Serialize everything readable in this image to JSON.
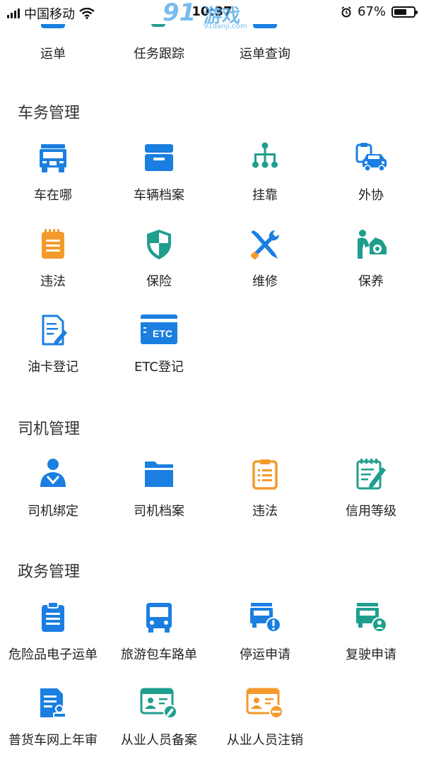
{
  "status_bar": {
    "carrier": "中国移动",
    "time": "10:37",
    "battery_percent": "67%",
    "battery_level": 0.67
  },
  "watermark": {
    "big": "91",
    "cn": "游戏",
    "small": "91danji.com"
  },
  "top_row": [
    {
      "label": "运单",
      "icon": "waybill-icon"
    },
    {
      "label": "任务跟踪",
      "icon": "task-tracking-icon"
    },
    {
      "label": "运单查询",
      "icon": "waybill-query-icon"
    }
  ],
  "sections": {
    "vehicle": {
      "title": "车务管理",
      "items": [
        {
          "label": "车在哪",
          "icon": "truck-icon"
        },
        {
          "label": "车辆档案",
          "icon": "archive-box-icon"
        },
        {
          "label": "挂靠",
          "icon": "hierarchy-icon"
        },
        {
          "label": "外协",
          "icon": "car-clipboard-icon"
        },
        {
          "label": "违法",
          "icon": "notepad-icon"
        },
        {
          "label": "保险",
          "icon": "shield-icon"
        },
        {
          "label": "维修",
          "icon": "tools-icon"
        },
        {
          "label": "保养",
          "icon": "car-maintenance-icon"
        },
        {
          "label": "油卡登记",
          "icon": "document-edit-icon"
        },
        {
          "label": "ETC登记",
          "icon": "etc-card-icon",
          "card_text": "ETC"
        }
      ]
    },
    "driver": {
      "title": "司机管理",
      "items": [
        {
          "label": "司机绑定",
          "icon": "driver-icon"
        },
        {
          "label": "司机档案",
          "icon": "folder-icon"
        },
        {
          "label": "违法",
          "icon": "clipboard-list-icon"
        },
        {
          "label": "信用等级",
          "icon": "notebook-pen-icon"
        }
      ]
    },
    "government": {
      "title": "政务管理",
      "items": [
        {
          "label": "危险品电子运单",
          "icon": "clipboard-icon"
        },
        {
          "label": "旅游包车路单",
          "icon": "bus-icon"
        },
        {
          "label": "停运申请",
          "icon": "truck-alert-icon"
        },
        {
          "label": "复驶申请",
          "icon": "truck-user-icon"
        },
        {
          "label": "普货车网上年审",
          "icon": "document-stamp-icon"
        },
        {
          "label": "从业人员备案",
          "icon": "id-card-edit-icon"
        },
        {
          "label": "从业人员注销",
          "icon": "id-card-remove-icon"
        }
      ]
    }
  },
  "colors": {
    "blue": "#1a7fe0",
    "teal": "#1f9e8e",
    "orange": "#f39a2b",
    "text": "#222222"
  }
}
